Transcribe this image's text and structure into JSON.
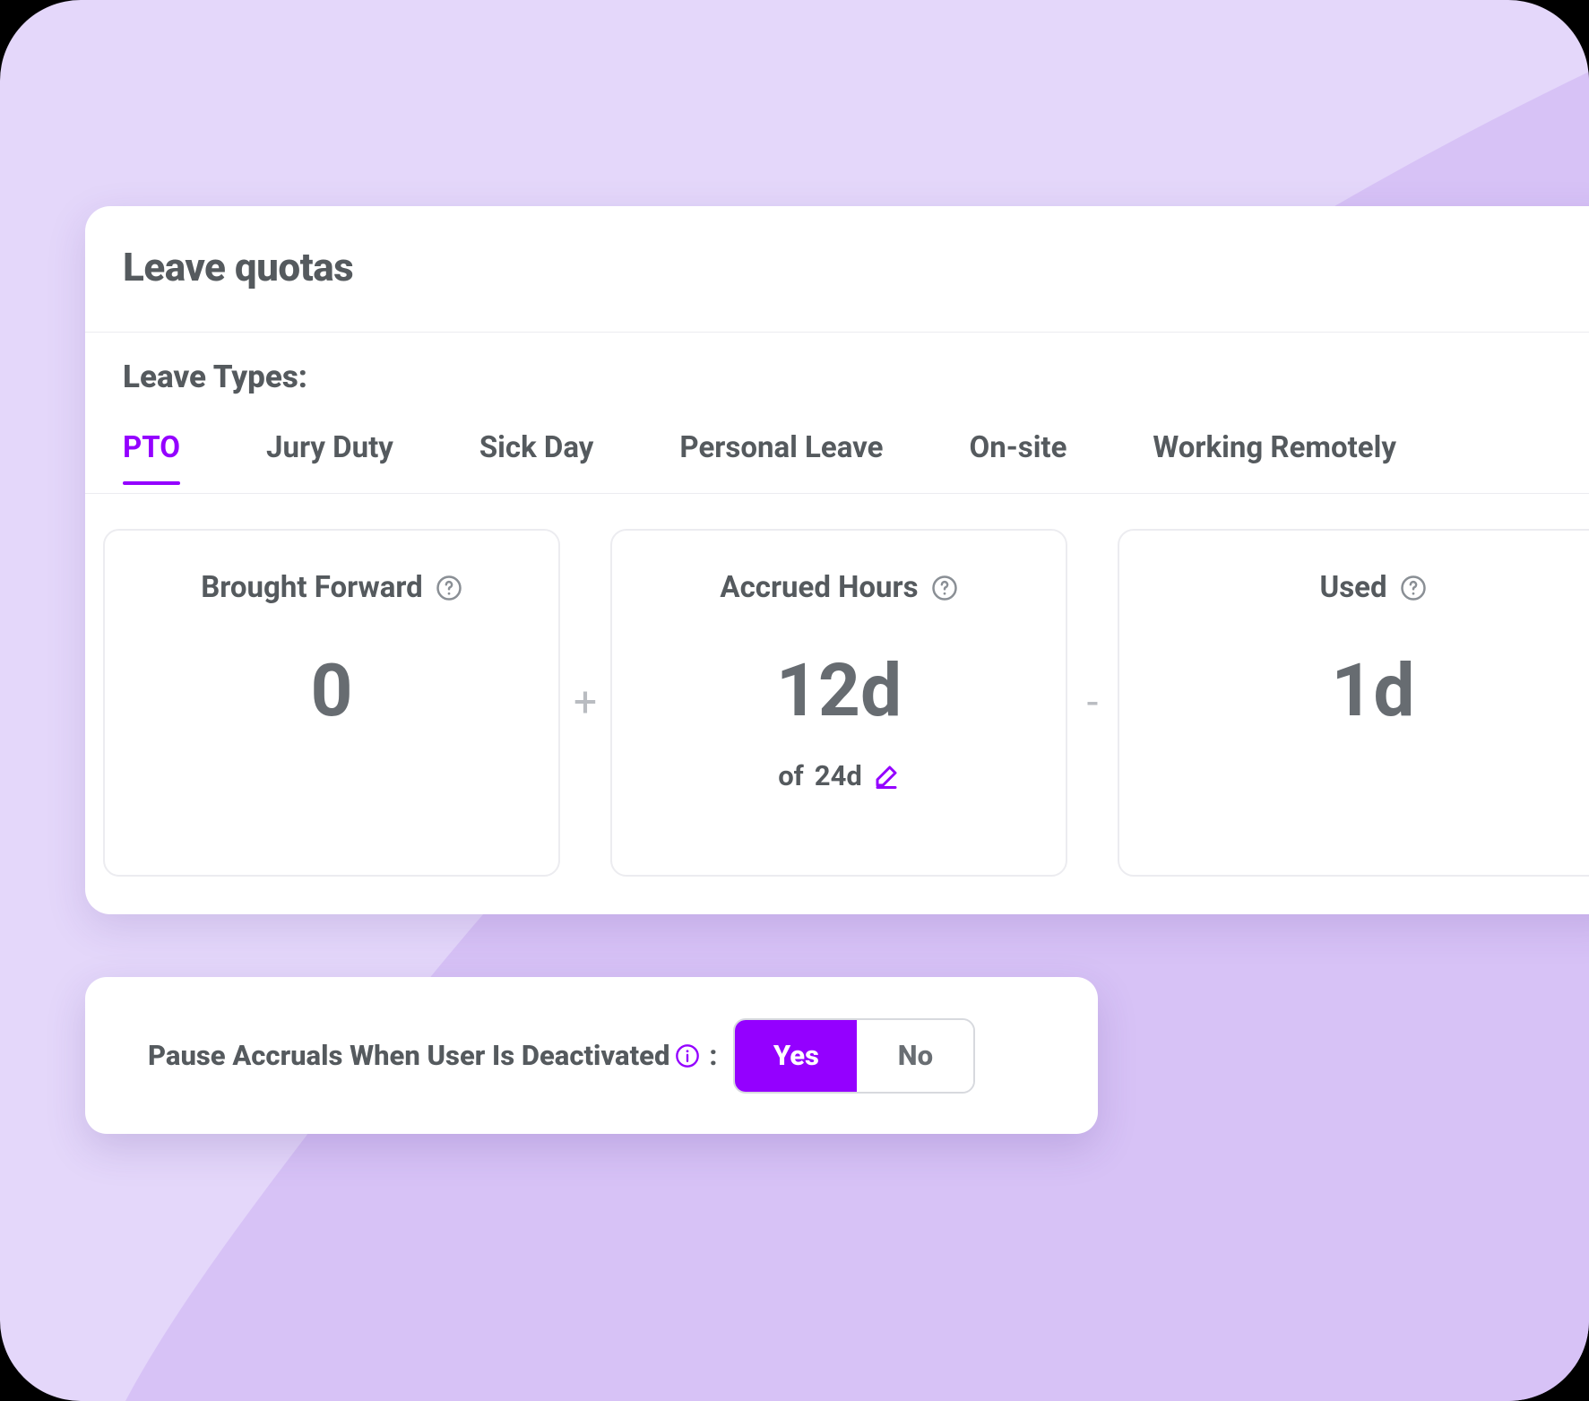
{
  "quotas": {
    "title": "Leave quotas",
    "types_label": "Leave Types:",
    "tabs": [
      "PTO",
      "Jury Duty",
      "Sick Day",
      "Personal Leave",
      "On-site",
      "Working Remotely"
    ],
    "active_tab": 0,
    "stats": {
      "brought_forward": {
        "label": "Brought Forward",
        "value": "0"
      },
      "accrued": {
        "label": "Accrued Hours",
        "value": "12d",
        "sub_prefix": "of",
        "sub_value": "24d"
      },
      "used": {
        "label": "Used",
        "value": "1d"
      },
      "op_plus": "+",
      "op_minus": "-"
    }
  },
  "pause": {
    "label": "Pause Accruals When User Is Deactivated",
    "yes": "Yes",
    "no": "No",
    "selected": "yes"
  },
  "colors": {
    "accent": "#9400ff"
  }
}
